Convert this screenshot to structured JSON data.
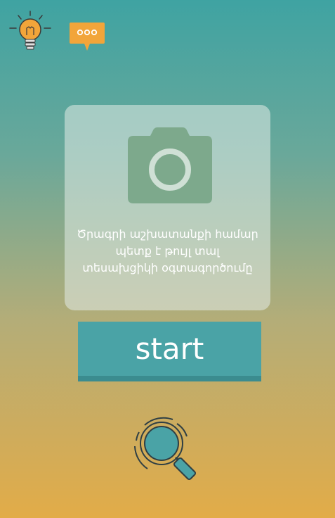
{
  "icons": {
    "top_left": "lightbulb-icon",
    "top_middle": "chat-bubble-icon",
    "card": "camera-icon",
    "bottom": "magnifier-icon"
  },
  "colors": {
    "accent": "#4aa3a6",
    "icon_orange": "#f2a53a",
    "camera": "#7da98c"
  },
  "card": {
    "message": "Ծրագրի աշխատանքի համար\nպետք է թույլ տալ\nտեսախցիկի օգտագործումը"
  },
  "start_button": {
    "label": "start"
  }
}
